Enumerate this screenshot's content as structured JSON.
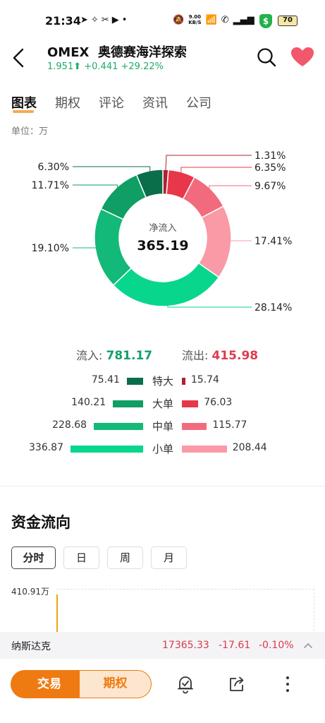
{
  "status_bar": {
    "time": "21:34",
    "net_speed": "9.00",
    "net_unit": "KB/S",
    "battery": "70",
    "shield": "$"
  },
  "header": {
    "ticker": "OMEX",
    "name": "奥德赛海洋探索",
    "price": "1.951",
    "change": "+0.441",
    "change_pct": "+29.22%",
    "up_arrow": "⬆"
  },
  "tabs": [
    {
      "label": "图表",
      "active": true
    },
    {
      "label": "期权",
      "active": false
    },
    {
      "label": "评论",
      "active": false
    },
    {
      "label": "资讯",
      "active": false
    },
    {
      "label": "公司",
      "active": false
    }
  ],
  "unit_label": "单位：万",
  "chart_data": {
    "type": "pie",
    "center_title": "净流入",
    "center_value": "365.19",
    "slices": [
      {
        "label": "1.31%",
        "value": 1.31,
        "color": "#b0202e"
      },
      {
        "label": "6.35%",
        "value": 6.35,
        "color": "#e8374b"
      },
      {
        "label": "9.67%",
        "value": 9.67,
        "color": "#f26b7d"
      },
      {
        "label": "17.41%",
        "value": 17.41,
        "color": "#f99aa6"
      },
      {
        "label": "28.14%",
        "value": 28.14,
        "color": "#08d68c"
      },
      {
        "label": "19.10%",
        "value": 19.1,
        "color": "#13b978"
      },
      {
        "label": "11.71%",
        "value": 11.71,
        "color": "#0f9e63"
      },
      {
        "label": "6.30%",
        "value": 6.3,
        "color": "#0b6e4a"
      }
    ]
  },
  "flow": {
    "in_label": "流入:",
    "in_total": "781.17",
    "out_label": "流出:",
    "out_total": "415.98",
    "rows": [
      {
        "category": "特大",
        "in": 75.41,
        "in_text": "75.41",
        "out": 15.74,
        "out_text": "15.74",
        "in_color": "#0b6e4a",
        "out_color": "#b0202e"
      },
      {
        "category": "大单",
        "in": 140.21,
        "in_text": "140.21",
        "out": 76.03,
        "out_text": "76.03",
        "in_color": "#0f9e63",
        "out_color": "#e8374b"
      },
      {
        "category": "中单",
        "in": 228.68,
        "in_text": "228.68",
        "out": 115.77,
        "out_text": "115.77",
        "in_color": "#13b978",
        "out_color": "#f26b7d"
      },
      {
        "category": "小单",
        "in": 336.87,
        "in_text": "336.87",
        "out": 208.44,
        "out_text": "208.44",
        "in_color": "#08d68c",
        "out_color": "#f99aa6"
      }
    ]
  },
  "capital_flow": {
    "title": "资金流向",
    "periods": [
      {
        "label": "分时",
        "active": true
      },
      {
        "label": "日",
        "active": false
      },
      {
        "label": "周",
        "active": false
      },
      {
        "label": "月",
        "active": false
      }
    ],
    "y_max_label": "410.91万"
  },
  "index_ticker": {
    "name": "纳斯达克",
    "price": "17365.33",
    "change": "-17.61",
    "change_pct": "-0.10%"
  },
  "bottom_nav": {
    "trade_label": "交易",
    "options_label": "期权"
  }
}
